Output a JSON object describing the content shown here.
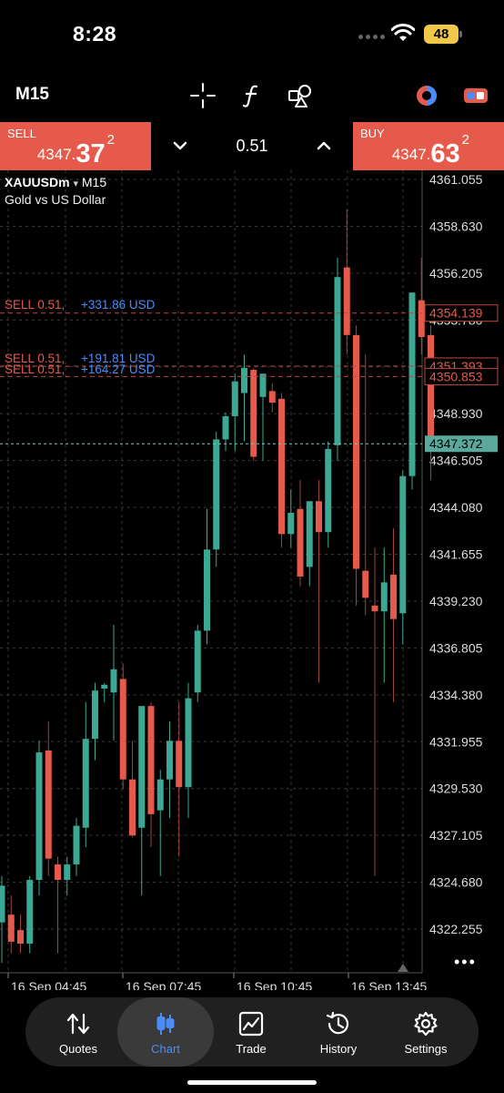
{
  "status": {
    "time": "8:28",
    "battery": "48"
  },
  "toolbar": {
    "timeframe": "M15",
    "icons": [
      "crosshair-icon",
      "indicator-f-icon",
      "objects-icon",
      "color-toggle-icon",
      "switch-toggle-icon"
    ]
  },
  "trade": {
    "sell": {
      "label": "SELL",
      "price_main": "4347.",
      "price_big": "37",
      "price_sup": "2"
    },
    "buy": {
      "label": "BUY",
      "price_main": "4347.",
      "price_big": "63",
      "price_sup": "2"
    },
    "lot": "0.51"
  },
  "chart": {
    "symbol": "XAUUSDm",
    "timeframe": "M15",
    "description": "Gold vs US Dollar",
    "dropdown_glyph": "▾"
  },
  "chart_data": {
    "type": "candlestick",
    "y_ticks": [
      "4361.055",
      "4358.630",
      "4356.205",
      "4353.780",
      "4351.355",
      "4348.930",
      "4346.505",
      "4344.080",
      "4341.655",
      "4339.230",
      "4336.805",
      "4334.380",
      "4331.955",
      "4329.530",
      "4327.105",
      "4324.680",
      "4322.255"
    ],
    "ylim": [
      4320.4,
      4362.2
    ],
    "x_ticks": [
      "16 Sep 04:45",
      "16 Sep 07:45",
      "16 Sep 10:45",
      "16 Sep 13:45"
    ],
    "current_price": "4347.372",
    "positions": [
      {
        "side": "SELL",
        "lot": "0.51,",
        "profit": "+331.86 USD",
        "price": 4354.139,
        "price_label": "4354.139"
      },
      {
        "side": "SELL",
        "lot": "0.51,",
        "profit": "+191.81 USD",
        "price": 4351.393,
        "price_label": "4351.393"
      },
      {
        "side": "SELL",
        "lot": "0.51,",
        "profit": "+164.27 USD",
        "price": 4350.853,
        "price_label": "4350.853"
      }
    ],
    "candles": [
      {
        "o": 4322.6,
        "h": 4325.0,
        "l": 4320.5,
        "c": 4324.5
      },
      {
        "o": 4323.0,
        "h": 4324.0,
        "l": 4321.0,
        "c": 4321.6
      },
      {
        "o": 4322.2,
        "h": 4323.0,
        "l": 4321.0,
        "c": 4321.5
      },
      {
        "o": 4321.5,
        "h": 4325.0,
        "l": 4321.0,
        "c": 4324.8
      },
      {
        "o": 4324.8,
        "h": 4332.0,
        "l": 4324.0,
        "c": 4331.4
      },
      {
        "o": 4331.5,
        "h": 4333.0,
        "l": 4325.0,
        "c": 4325.9
      },
      {
        "o": 4325.6,
        "h": 4326.0,
        "l": 4321.0,
        "c": 4324.8
      },
      {
        "o": 4324.8,
        "h": 4326.0,
        "l": 4324.0,
        "c": 4325.6
      },
      {
        "o": 4325.6,
        "h": 4328.0,
        "l": 4325.0,
        "c": 4327.6
      },
      {
        "o": 4327.5,
        "h": 4334.0,
        "l": 4326.5,
        "c": 4332.1
      },
      {
        "o": 4332.1,
        "h": 4335.0,
        "l": 4331.0,
        "c": 4334.6
      },
      {
        "o": 4334.7,
        "h": 4335.0,
        "l": 4334.0,
        "c": 4334.9
      },
      {
        "o": 4334.5,
        "h": 4338.0,
        "l": 4332.0,
        "c": 4335.7
      },
      {
        "o": 4335.2,
        "h": 4336.0,
        "l": 4329.5,
        "c": 4330.0
      },
      {
        "o": 4330.0,
        "h": 4332.0,
        "l": 4327.0,
        "c": 4327.1
      },
      {
        "o": 4327.5,
        "h": 4331.0,
        "l": 4324.0,
        "c": 4333.8
      },
      {
        "o": 4333.8,
        "h": 4334.0,
        "l": 4326.5,
        "c": 4328.2
      },
      {
        "o": 4328.4,
        "h": 4330.5,
        "l": 4325.0,
        "c": 4330.0
      },
      {
        "o": 4330.0,
        "h": 4333.0,
        "l": 4328.0,
        "c": 4332.0
      },
      {
        "o": 4332.0,
        "h": 4334.0,
        "l": 4326.0,
        "c": 4329.6
      },
      {
        "o": 4329.6,
        "h": 4335.0,
        "l": 4328.0,
        "c": 4334.2
      },
      {
        "o": 4334.5,
        "h": 4338.0,
        "l": 4334.0,
        "c": 4337.7
      },
      {
        "o": 4337.7,
        "h": 4344.0,
        "l": 4337.0,
        "c": 4341.9
      },
      {
        "o": 4341.9,
        "h": 4348.0,
        "l": 4341.0,
        "c": 4347.6
      },
      {
        "o": 4347.6,
        "h": 4349.0,
        "l": 4347.0,
        "c": 4348.8
      },
      {
        "o": 4348.8,
        "h": 4351.0,
        "l": 4347.0,
        "c": 4350.6
      },
      {
        "o": 4350.0,
        "h": 4352.0,
        "l": 4347.5,
        "c": 4351.3
      },
      {
        "o": 4351.2,
        "h": 4351.3,
        "l": 4346.5,
        "c": 4346.7
      },
      {
        "o": 4349.8,
        "h": 4351.0,
        "l": 4346.5,
        "c": 4351.0
      },
      {
        "o": 4350.1,
        "h": 4350.5,
        "l": 4349.0,
        "c": 4349.5
      },
      {
        "o": 4349.7,
        "h": 4350.0,
        "l": 4342.0,
        "c": 4342.7
      },
      {
        "o": 4342.7,
        "h": 4345.0,
        "l": 4342.0,
        "c": 4343.8
      },
      {
        "o": 4344.0,
        "h": 4345.5,
        "l": 4340.0,
        "c": 4340.5
      },
      {
        "o": 4341.0,
        "h": 4344.0,
        "l": 4340.0,
        "c": 4344.4
      },
      {
        "o": 4344.4,
        "h": 4345.5,
        "l": 4335.0,
        "c": 4342.8
      },
      {
        "o": 4342.8,
        "h": 4347.5,
        "l": 4342.0,
        "c": 4347.1
      },
      {
        "o": 4347.3,
        "h": 4357.0,
        "l": 4346.5,
        "c": 4356.0
      },
      {
        "o": 4356.5,
        "h": 4359.5,
        "l": 4352.0,
        "c": 4353.0
      },
      {
        "o": 4353.0,
        "h": 4353.5,
        "l": 4339.0,
        "c": 4340.9
      },
      {
        "o": 4340.8,
        "h": 4352.0,
        "l": 4338.5,
        "c": 4339.4
      },
      {
        "o": 4339.0,
        "h": 4342.0,
        "l": 4325.0,
        "c": 4338.7
      },
      {
        "o": 4338.7,
        "h": 4342.0,
        "l": 4335.0,
        "c": 4340.2
      },
      {
        "o": 4340.6,
        "h": 4343.0,
        "l": 4334.0,
        "c": 4338.3
      },
      {
        "o": 4338.6,
        "h": 4346.0,
        "l": 4337.0,
        "c": 4345.7
      },
      {
        "o": 4345.7,
        "h": 4355.0,
        "l": 4345.0,
        "c": 4355.2
      },
      {
        "o": 4354.8,
        "h": 4357.0,
        "l": 4352.0,
        "c": 4352.9
      },
      {
        "o": 4353.0,
        "h": 4353.5,
        "l": 4345.5,
        "c": 4347.4
      }
    ]
  },
  "nav": {
    "items": [
      {
        "key": "quotes",
        "label": "Quotes",
        "icon": "quotes-icon"
      },
      {
        "key": "chart",
        "label": "Chart",
        "icon": "chart-candles-icon",
        "active": true
      },
      {
        "key": "trade",
        "label": "Trade",
        "icon": "trade-icon"
      },
      {
        "key": "history",
        "label": "History",
        "icon": "history-icon"
      },
      {
        "key": "settings",
        "label": "Settings",
        "icon": "settings-icon"
      }
    ]
  },
  "colors": {
    "up": "#3aa893",
    "down": "#e55a4b",
    "accent": "#4a8df8",
    "grid": "#3a3a3a",
    "current_line": "#7cc8c0"
  }
}
